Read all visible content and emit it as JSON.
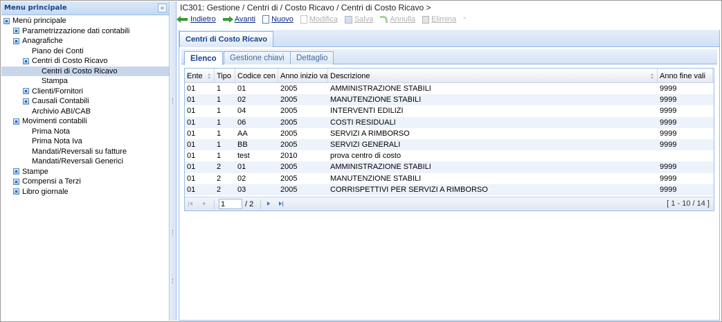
{
  "sidebar": {
    "title": "Menu principale",
    "collapse_glyph": "«",
    "items": [
      {
        "label": "Menù principale",
        "indent": 0,
        "icon": "folder-icon"
      },
      {
        "label": "Parametrizzazione dati contabili",
        "indent": 1,
        "icon": "folder-icon"
      },
      {
        "label": "Anagrafiche",
        "indent": 1,
        "icon": "folder-icon"
      },
      {
        "label": "Piano dei Conti",
        "indent": 2,
        "icon": ""
      },
      {
        "label": "Centri di Costo Ricavo",
        "indent": 2,
        "icon": "folder-icon"
      },
      {
        "label": "Centri di Costo Ricavo",
        "indent": 3,
        "icon": "",
        "selected": true
      },
      {
        "label": "Stampa",
        "indent": 3,
        "icon": ""
      },
      {
        "label": "Clienti/Fornitori",
        "indent": 2,
        "icon": "folder-icon"
      },
      {
        "label": "Causali Contabili",
        "indent": 2,
        "icon": "folder-icon"
      },
      {
        "label": "Archivio ABI/CAB",
        "indent": 2,
        "icon": ""
      },
      {
        "label": "Movimenti contabili",
        "indent": 1,
        "icon": "folder-icon"
      },
      {
        "label": "Prima Nota",
        "indent": 2,
        "icon": ""
      },
      {
        "label": "Prima Nota Iva",
        "indent": 2,
        "icon": ""
      },
      {
        "label": "Mandati/Reversali su fatture",
        "indent": 2,
        "icon": ""
      },
      {
        "label": "Mandati/Reversali Generici",
        "indent": 2,
        "icon": ""
      },
      {
        "label": "Stampe",
        "indent": 1,
        "icon": "folder-icon"
      },
      {
        "label": "Compensi a Terzi",
        "indent": 1,
        "icon": "folder-icon"
      },
      {
        "label": "Libro giornale",
        "indent": 1,
        "icon": "folder-icon"
      }
    ]
  },
  "breadcrumb": "IC301: Gestione / Centri di / Costo Ricavo / Centri di Costo Ricavo >",
  "toolbar": {
    "back": "Indietro",
    "forward": "Avanti",
    "new": "Nuovo",
    "edit": "Modifica",
    "save": "Salva",
    "cancel": "Annulla",
    "delete": "Elimina",
    "sep": "*"
  },
  "panel": {
    "tab_title": "Centri di Costo Ricavo",
    "subtabs": [
      "Elenco",
      "Gestione chiavi",
      "Dettaglio"
    ]
  },
  "grid": {
    "columns": [
      "Ente",
      "Tipo",
      "Codice cen",
      "Anno inizio va",
      "Descrizione",
      "Anno fine vali"
    ],
    "rows": [
      [
        "01",
        "1",
        "01",
        "2005",
        "AMMINISTRAZIONE STABILI",
        "9999"
      ],
      [
        "01",
        "1",
        "02",
        "2005",
        "MANUTENZIONE STABILI",
        "9999"
      ],
      [
        "01",
        "1",
        "04",
        "2005",
        "INTERVENTI EDILIZI",
        "9999"
      ],
      [
        "01",
        "1",
        "06",
        "2005",
        "COSTI RESIDUALI",
        "9999"
      ],
      [
        "01",
        "1",
        "AA",
        "2005",
        "SERVIZI A RIMBORSO",
        "9999"
      ],
      [
        "01",
        "1",
        "BB",
        "2005",
        "SERVIZI GENERALI",
        "9999"
      ],
      [
        "01",
        "1",
        "test",
        "2010",
        "prova centro di costo",
        ""
      ],
      [
        "01",
        "2",
        "01",
        "2005",
        "AMMINISTRAZIONE STABILI",
        "9999"
      ],
      [
        "01",
        "2",
        "02",
        "2005",
        "MANUTENZIONE STABILI",
        "9999"
      ],
      [
        "01",
        "2",
        "03",
        "2005",
        "CORRISPETTIVI PER SERVIZI A RIMBORSO",
        "9999"
      ]
    ]
  },
  "pager": {
    "page": "1",
    "total": "/ 2",
    "info": "[ 1 - 10 / 14 ]"
  }
}
